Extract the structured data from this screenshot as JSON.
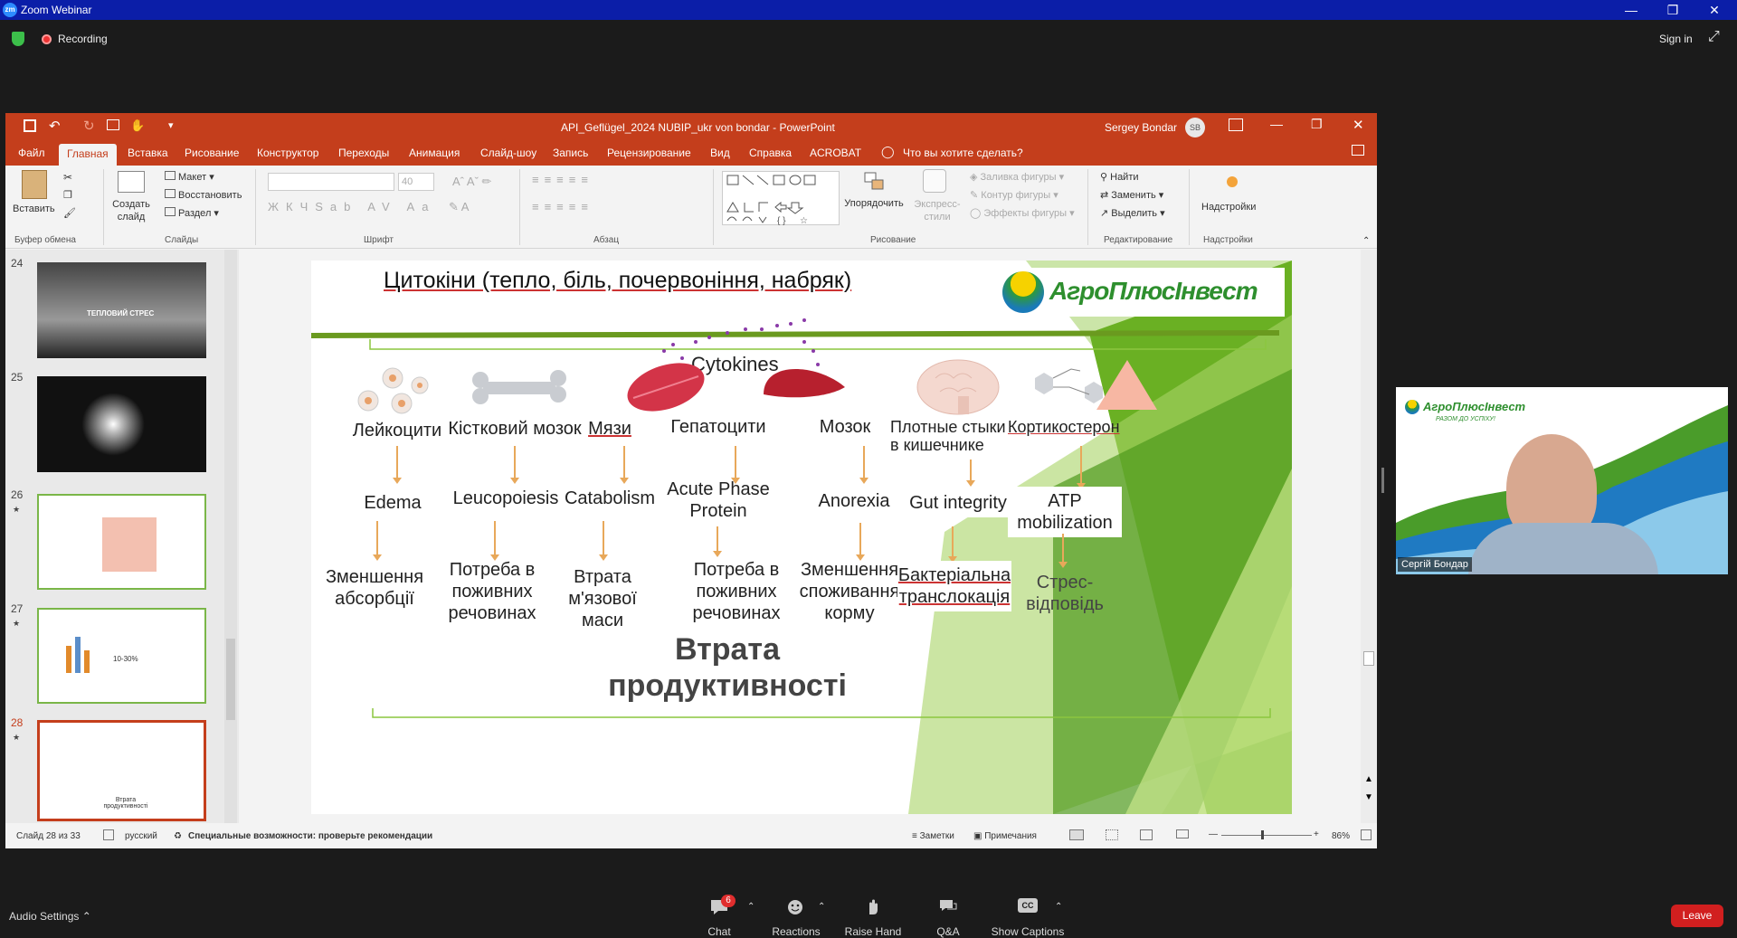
{
  "zoom": {
    "title": "Zoom Webinar",
    "logo": "zm",
    "recording": "Recording",
    "sign_in": "Sign in"
  },
  "ppt": {
    "title": "API_Geflügel_2024 NUBIP_ukr von bondar - PowerPoint",
    "user": "Sergey Bondar",
    "user_initials": "SB",
    "tabs": [
      "Файл",
      "Главная",
      "Вставка",
      "Рисование",
      "Конструктор",
      "Переходы",
      "Анимация",
      "Слайд-шоу",
      "Запись",
      "Рецензирование",
      "Вид",
      "Справка",
      "ACROBAT"
    ],
    "tell_me": "Что вы хотите сделать?",
    "ribbon": {
      "paste": "Вставить",
      "clipboard": "Буфер обмена",
      "new_slide": "Создать слайд",
      "layout": "Макет",
      "reset": "Восстановить",
      "section": "Раздел",
      "slides": "Слайды",
      "font_size": "40",
      "font": "Шрифт",
      "paragraph": "Абзац",
      "arrange": "Упорядочить",
      "quick_styles": "Экспресс-стили",
      "shape_fill": "Заливка фигуры",
      "shape_outline": "Контур фигуры",
      "shape_effects": "Эффекты фигуры",
      "drawing": "Рисование",
      "find": "Найти",
      "replace": "Заменить",
      "select": "Выделить",
      "editing": "Редактирование",
      "addins_btn": "Надстройки",
      "addins": "Надстройки"
    },
    "thumbnails": [
      {
        "num": "24",
        "caption": "ТЕПЛОВИЙ СТРЕС"
      },
      {
        "num": "25"
      },
      {
        "num": "26"
      },
      {
        "num": "27",
        "caption": "10-30%"
      },
      {
        "num": "28",
        "caption": "Втрата продуктивності"
      }
    ],
    "status": {
      "slide": "Слайд 28 из 33",
      "lang": "русский",
      "accessibility": "Специальные возможности: проверьте рекомендации",
      "notes": "Заметки",
      "comments": "Примечания",
      "zoom": "86%"
    }
  },
  "slide": {
    "title": "Цитокіни (тепло, біль, почервоніння, набряк)",
    "logo": "АгроПлюсІнвест",
    "center": "Cytokines",
    "sources": [
      "Лейкоцити",
      "Кістковий мозок",
      "Мязи",
      "Гепатоцити",
      "Мозок",
      "Плотные стыки в кишечнике",
      "Кортикостерон"
    ],
    "effects": [
      "Edema",
      "Leucopoiesis",
      "Catabolism",
      "Acute Phase Protein",
      "Anorexia",
      "Gut integrity",
      "ATP mobilization"
    ],
    "outcomes": [
      "Зменшення абсорбції",
      "Потреба в поживних речовинах",
      "Втрата м'язової маси",
      "Потреба в поживних речовинах",
      "Зменшення споживання корму",
      "Бактеріальна транслокація",
      "Стрес-відповідь"
    ],
    "footer_line1": "Втрата",
    "footer_line2": "продуктивності"
  },
  "video": {
    "logo": "АгроПлюсІнвест",
    "slogan": "РАЗОМ ДО УСПІХУ!",
    "name": "Сергій Бондар"
  },
  "bottom": {
    "audio_settings": "Audio Settings",
    "chat": "Chat",
    "chat_badge": "6",
    "reactions": "Reactions",
    "raise_hand": "Raise Hand",
    "qa": "Q&A",
    "captions": "Show Captions",
    "captions_icon": "CC",
    "leave": "Leave"
  }
}
